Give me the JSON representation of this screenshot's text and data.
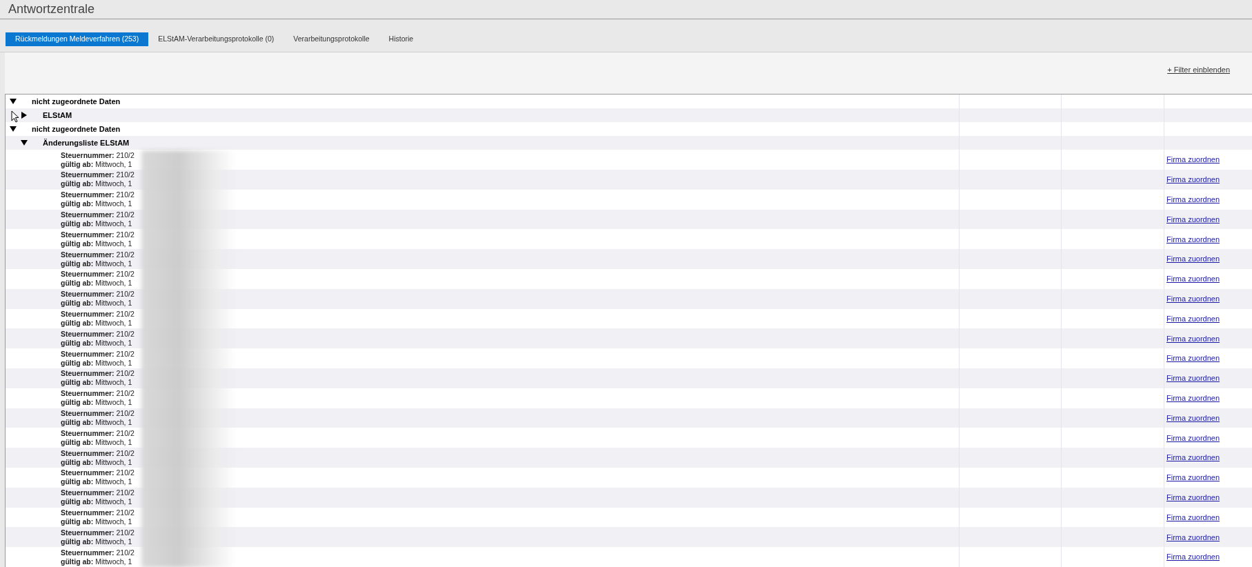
{
  "title": "Antwortzentrale",
  "tabs": [
    {
      "label": "Rückmeldungen Meldeverfahren (253)",
      "selected": true
    },
    {
      "label": "ELStAM-Verarbeitungsprotokolle (0)",
      "selected": false
    },
    {
      "label": "Verarbeitungsprotokolle",
      "selected": false
    },
    {
      "label": "Historie",
      "selected": false
    }
  ],
  "filter_link": "+ Filter einblenden",
  "tree": [
    {
      "label": "nicht zugeordnete Daten",
      "expanded": true,
      "children": [
        {
          "label": "ELStAM",
          "expanded": false
        }
      ]
    },
    {
      "label": "nicht zugeordnete Daten",
      "expanded": true,
      "children": [
        {
          "label": "Änderungsliste ELStAM",
          "expanded": true,
          "entries": [
            {
              "tax_number": "**Steuernummer:** 210/2",
              "valid_from": "**gültig ab:** Mittwoch, 1",
              "action": "Firma zuordnen"
            },
            {
              "tax_number": "**Steuernummer:** 210/2",
              "valid_from": "**gültig ab:** Mittwoch, 1",
              "action": "Firma zuordnen"
            },
            {
              "tax_number": "**Steuernummer:** 210/2",
              "valid_from": "**gültig ab:** Mittwoch, 1",
              "action": "Firma zuordnen"
            },
            {
              "tax_number": "**Steuernummer:** 210/2",
              "valid_from": "**gültig ab:** Mittwoch, 1",
              "action": "Firma zuordnen"
            },
            {
              "tax_number": "**Steuernummer:** 210/2",
              "valid_from": "**gültig ab:** Mittwoch, 1",
              "action": "Firma zuordnen"
            },
            {
              "tax_number": "**Steuernummer:** 210/2",
              "valid_from": "**gültig ab:** Mittwoch, 1",
              "action": "Firma zuordnen"
            },
            {
              "tax_number": "**Steuernummer:** 210/2",
              "valid_from": "**gültig ab:** Mittwoch, 1",
              "action": "Firma zuordnen"
            },
            {
              "tax_number": "**Steuernummer:** 210/2",
              "valid_from": "**gültig ab:** Mittwoch, 1",
              "action": "Firma zuordnen"
            },
            {
              "tax_number": "**Steuernummer:** 210/2",
              "valid_from": "**gültig ab:** Mittwoch, 1",
              "action": "Firma zuordnen"
            },
            {
              "tax_number": "**Steuernummer:** 210/2",
              "valid_from": "**gültig ab:** Mittwoch, 1",
              "action": "Firma zuordnen"
            },
            {
              "tax_number": "**Steuernummer:** 210/2",
              "valid_from": "**gültig ab:** Mittwoch, 1",
              "action": "Firma zuordnen"
            },
            {
              "tax_number": "**Steuernummer:** 210/2",
              "valid_from": "**gültig ab:** Mittwoch, 1",
              "action": "Firma zuordnen"
            },
            {
              "tax_number": "**Steuernummer:** 210/2",
              "valid_from": "**gültig ab:** Mittwoch, 1",
              "action": "Firma zuordnen"
            },
            {
              "tax_number": "**Steuernummer:** 210/2",
              "valid_from": "**gültig ab:** Mittwoch, 1",
              "action": "Firma zuordnen"
            },
            {
              "tax_number": "**Steuernummer:** 210/2",
              "valid_from": "**gültig ab:** Mittwoch, 1",
              "action": "Firma zuordnen"
            },
            {
              "tax_number": "**Steuernummer:** 210/2",
              "valid_from": "**gültig ab:** Mittwoch, 1",
              "action": "Firma zuordnen"
            },
            {
              "tax_number": "**Steuernummer:** 210/2",
              "valid_from": "**gültig ab:** Mittwoch, 1",
              "action": "Firma zuordnen"
            },
            {
              "tax_number": "**Steuernummer:** 210/2",
              "valid_from": "**gültig ab:** Mittwoch, 1",
              "action": "Firma zuordnen"
            },
            {
              "tax_number": "**Steuernummer:** 210/2",
              "valid_from": "**gültig ab:** Mittwoch, 1",
              "action": "Firma zuordnen"
            },
            {
              "tax_number": "**Steuernummer:** 210/2",
              "valid_from": "**gültig ab:** Mittwoch, 1",
              "action": "Firma zuordnen"
            },
            {
              "tax_number": "**Steuernummer:** 210/2",
              "valid_from": "**gültig ab:** Mittwoch, 1",
              "action": "Firma zuordnen"
            }
          ]
        }
      ]
    }
  ]
}
